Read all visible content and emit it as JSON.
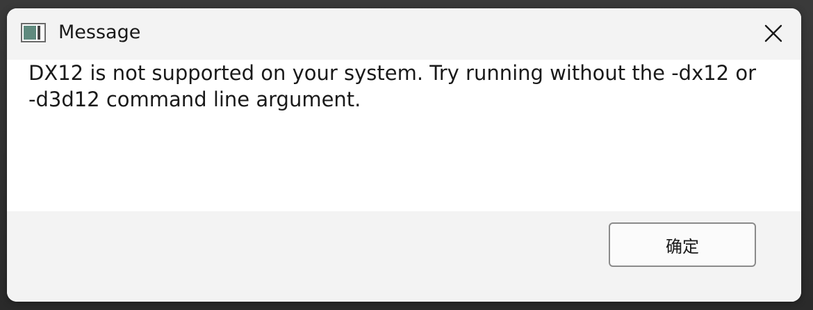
{
  "dialog": {
    "title": "Message",
    "message": "DX12 is not supported on your system. Try running without the -dx12 or\n-d3d12 command line argument.",
    "ok_label": "确定"
  },
  "icons": {
    "app": "app-window-icon",
    "close": "close-icon"
  },
  "colors": {
    "titlebar_bg": "#f3f3f3",
    "body_bg": "#ffffff",
    "footer_bg": "#f3f3f3",
    "icon_fill": "#5f8a7e"
  }
}
